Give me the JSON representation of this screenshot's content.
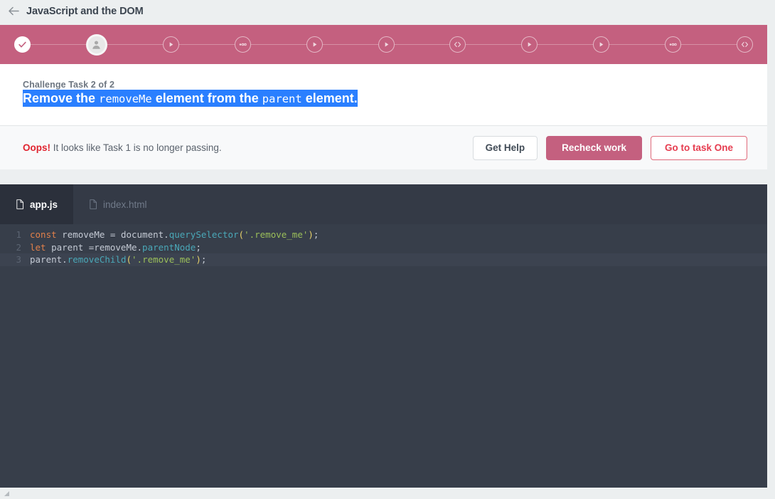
{
  "titlebar": {
    "back_icon": "back-arrow-icon",
    "title": "JavaScript and the DOM"
  },
  "progress": {
    "accent_color": "#c4607f",
    "steps": [
      {
        "icon": "check-icon",
        "state": "done",
        "name": "step-1-complete"
      },
      {
        "icon": "person-icon",
        "state": "current",
        "name": "step-2-current"
      },
      {
        "icon": "play-icon",
        "state": "upcoming",
        "name": "step-3-video"
      },
      {
        "icon": "quiz-dots-icon",
        "state": "upcoming",
        "name": "step-4-quiz"
      },
      {
        "icon": "play-icon",
        "state": "upcoming",
        "name": "step-5-video"
      },
      {
        "icon": "play-icon",
        "state": "upcoming",
        "name": "step-6-video"
      },
      {
        "icon": "code-icon",
        "state": "upcoming",
        "name": "step-7-code"
      },
      {
        "icon": "play-icon",
        "state": "upcoming",
        "name": "step-8-video"
      },
      {
        "icon": "play-icon",
        "state": "upcoming",
        "name": "step-9-video"
      },
      {
        "icon": "quiz-dots-icon",
        "state": "upcoming",
        "name": "step-10-quiz"
      },
      {
        "icon": "code-icon",
        "state": "upcoming",
        "name": "step-11-code"
      }
    ]
  },
  "task": {
    "label": "Challenge Task 2 of 2",
    "heading": {
      "selected": true,
      "parts": [
        {
          "text": "Remove the ",
          "type": "text"
        },
        {
          "text": "removeMe",
          "type": "code"
        },
        {
          "text": " element from the ",
          "type": "text"
        },
        {
          "text": "parent",
          "type": "code"
        },
        {
          "text": " element.",
          "type": "text"
        }
      ]
    }
  },
  "status": {
    "prefix": "Oops!",
    "message": " It looks like Task 1 is no longer passing.",
    "prefix_color": "#e0232e"
  },
  "buttons": {
    "get_help": "Get Help",
    "recheck": "Recheck work",
    "go_to_task_one": "Go to task One"
  },
  "editor": {
    "tabs": [
      {
        "label": "app.js",
        "active": true,
        "icon": "file-icon"
      },
      {
        "label": "index.html",
        "active": false,
        "icon": "file-icon"
      }
    ],
    "lines": [
      {
        "number": "1",
        "active": false,
        "tokens": [
          {
            "t": "const",
            "c": "kw"
          },
          {
            "t": " removeMe = document.",
            "c": ""
          },
          {
            "t": "querySelector",
            "c": "fn"
          },
          {
            "t": "(",
            "c": "pn"
          },
          {
            "t": "'.remove_me'",
            "c": "str"
          },
          {
            "t": ")",
            "c": "pn"
          },
          {
            "t": ";",
            "c": ""
          }
        ]
      },
      {
        "number": "2",
        "active": false,
        "tokens": [
          {
            "t": "let",
            "c": "kw"
          },
          {
            "t": " parent =removeMe.",
            "c": ""
          },
          {
            "t": "parentNode",
            "c": "fn"
          },
          {
            "t": ";",
            "c": ""
          }
        ]
      },
      {
        "number": "3",
        "active": true,
        "tokens": [
          {
            "t": "parent.",
            "c": ""
          },
          {
            "t": "removeChild",
            "c": "fn"
          },
          {
            "t": "(",
            "c": "pn"
          },
          {
            "t": "'.remove_me'",
            "c": "str"
          },
          {
            "t": ")",
            "c": "pn"
          },
          {
            "t": ";",
            "c": ""
          }
        ]
      }
    ]
  },
  "scrollbar": {
    "nub_icon": "scroll-corner-icon"
  }
}
